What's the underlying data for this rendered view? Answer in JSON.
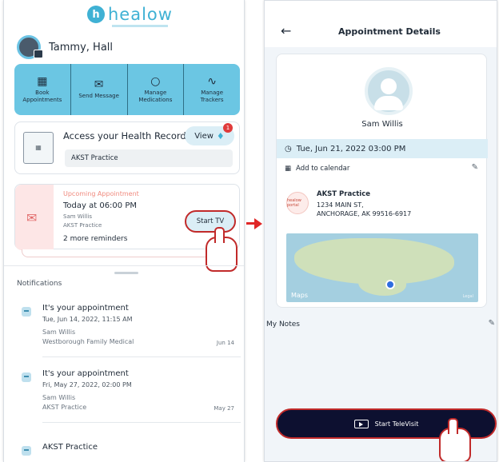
{
  "left": {
    "logo_text": "healow",
    "user_name": "Tammy, Hall",
    "actions": [
      {
        "label": "Book\nAppointments",
        "icon": "calendar-search-icon"
      },
      {
        "label": "Send Message",
        "icon": "envelope-icon"
      },
      {
        "label": "Manage\nMedications",
        "icon": "pill-icon"
      },
      {
        "label": "Manage\nTrackers",
        "icon": "pulse-icon"
      }
    ],
    "records": {
      "title": "Access your Health Records",
      "view_label": "View",
      "badge_count": "1",
      "practice": "AKST Practice"
    },
    "appointment": {
      "kicker": "Upcoming Appointment",
      "time": "Today at 06:00 PM",
      "doctor": "Sam Willis",
      "location": "AKST Practice",
      "more": "2 more reminders",
      "start_label": "Start TV"
    },
    "notifications_header": "Notifications",
    "notifications": [
      {
        "title": "It's your appointment",
        "date": "Tue, Jun 14, 2022, 11:15 AM",
        "doctor": "Sam Willis",
        "location": "Westborough Family Medical",
        "short_date": "Jun 14"
      },
      {
        "title": "It's your appointment",
        "date": "Fri, May 27, 2022, 02:00 PM",
        "doctor": "Sam Willis",
        "location": "AKST Practice",
        "short_date": "May 27"
      },
      {
        "title": "AKST Practice",
        "date": "",
        "doctor": "",
        "location": "",
        "short_date": ""
      }
    ]
  },
  "right": {
    "title": "Appointment Details",
    "name": "Sam Willis",
    "datetime": "Tue, Jun 21, 2022 03:00 PM",
    "calendar_label": "Add to calendar",
    "practice_logo_text": "healow portal",
    "practice_name": "AKST Practice",
    "address_line1": "1234 MAIN ST,",
    "address_line2": "ANCHORAGE, AK 99516-6917",
    "maps_label": "Maps",
    "legal_label": "Legal",
    "notes_label": "My Notes",
    "televisit_label": "Start TeleVisit"
  },
  "colors": {
    "brand": "#3fb1d4",
    "highlight": "#c12a2a",
    "arrow": "#e02727",
    "televisit_bg": "#0d1030"
  }
}
